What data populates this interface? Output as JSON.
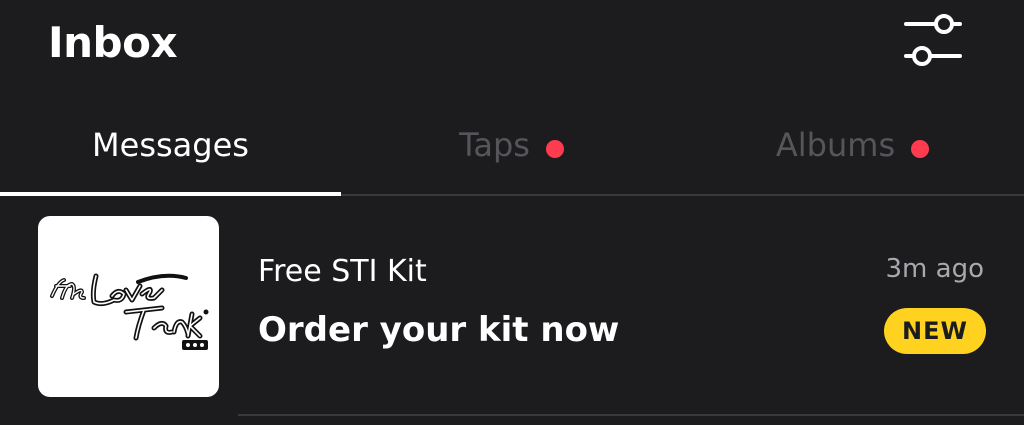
{
  "header": {
    "title": "Inbox",
    "filter_icon": "sliders-icon"
  },
  "tabs": [
    {
      "label": "Messages",
      "active": true,
      "has_dot": false
    },
    {
      "label": "Taps",
      "active": false,
      "has_dot": true
    },
    {
      "label": "Albums",
      "active": false,
      "has_dot": true
    }
  ],
  "messages": [
    {
      "sender": "Free STI Kit",
      "subject": "Order your kit now",
      "time": "3m ago",
      "badge": "NEW",
      "logo_icon": "the-love-tank-logo"
    }
  ],
  "colors": {
    "background": "#1c1c1e",
    "badge": "#ffd21f",
    "dot": "#ff3b4f",
    "inactive_tab": "#55555a"
  }
}
